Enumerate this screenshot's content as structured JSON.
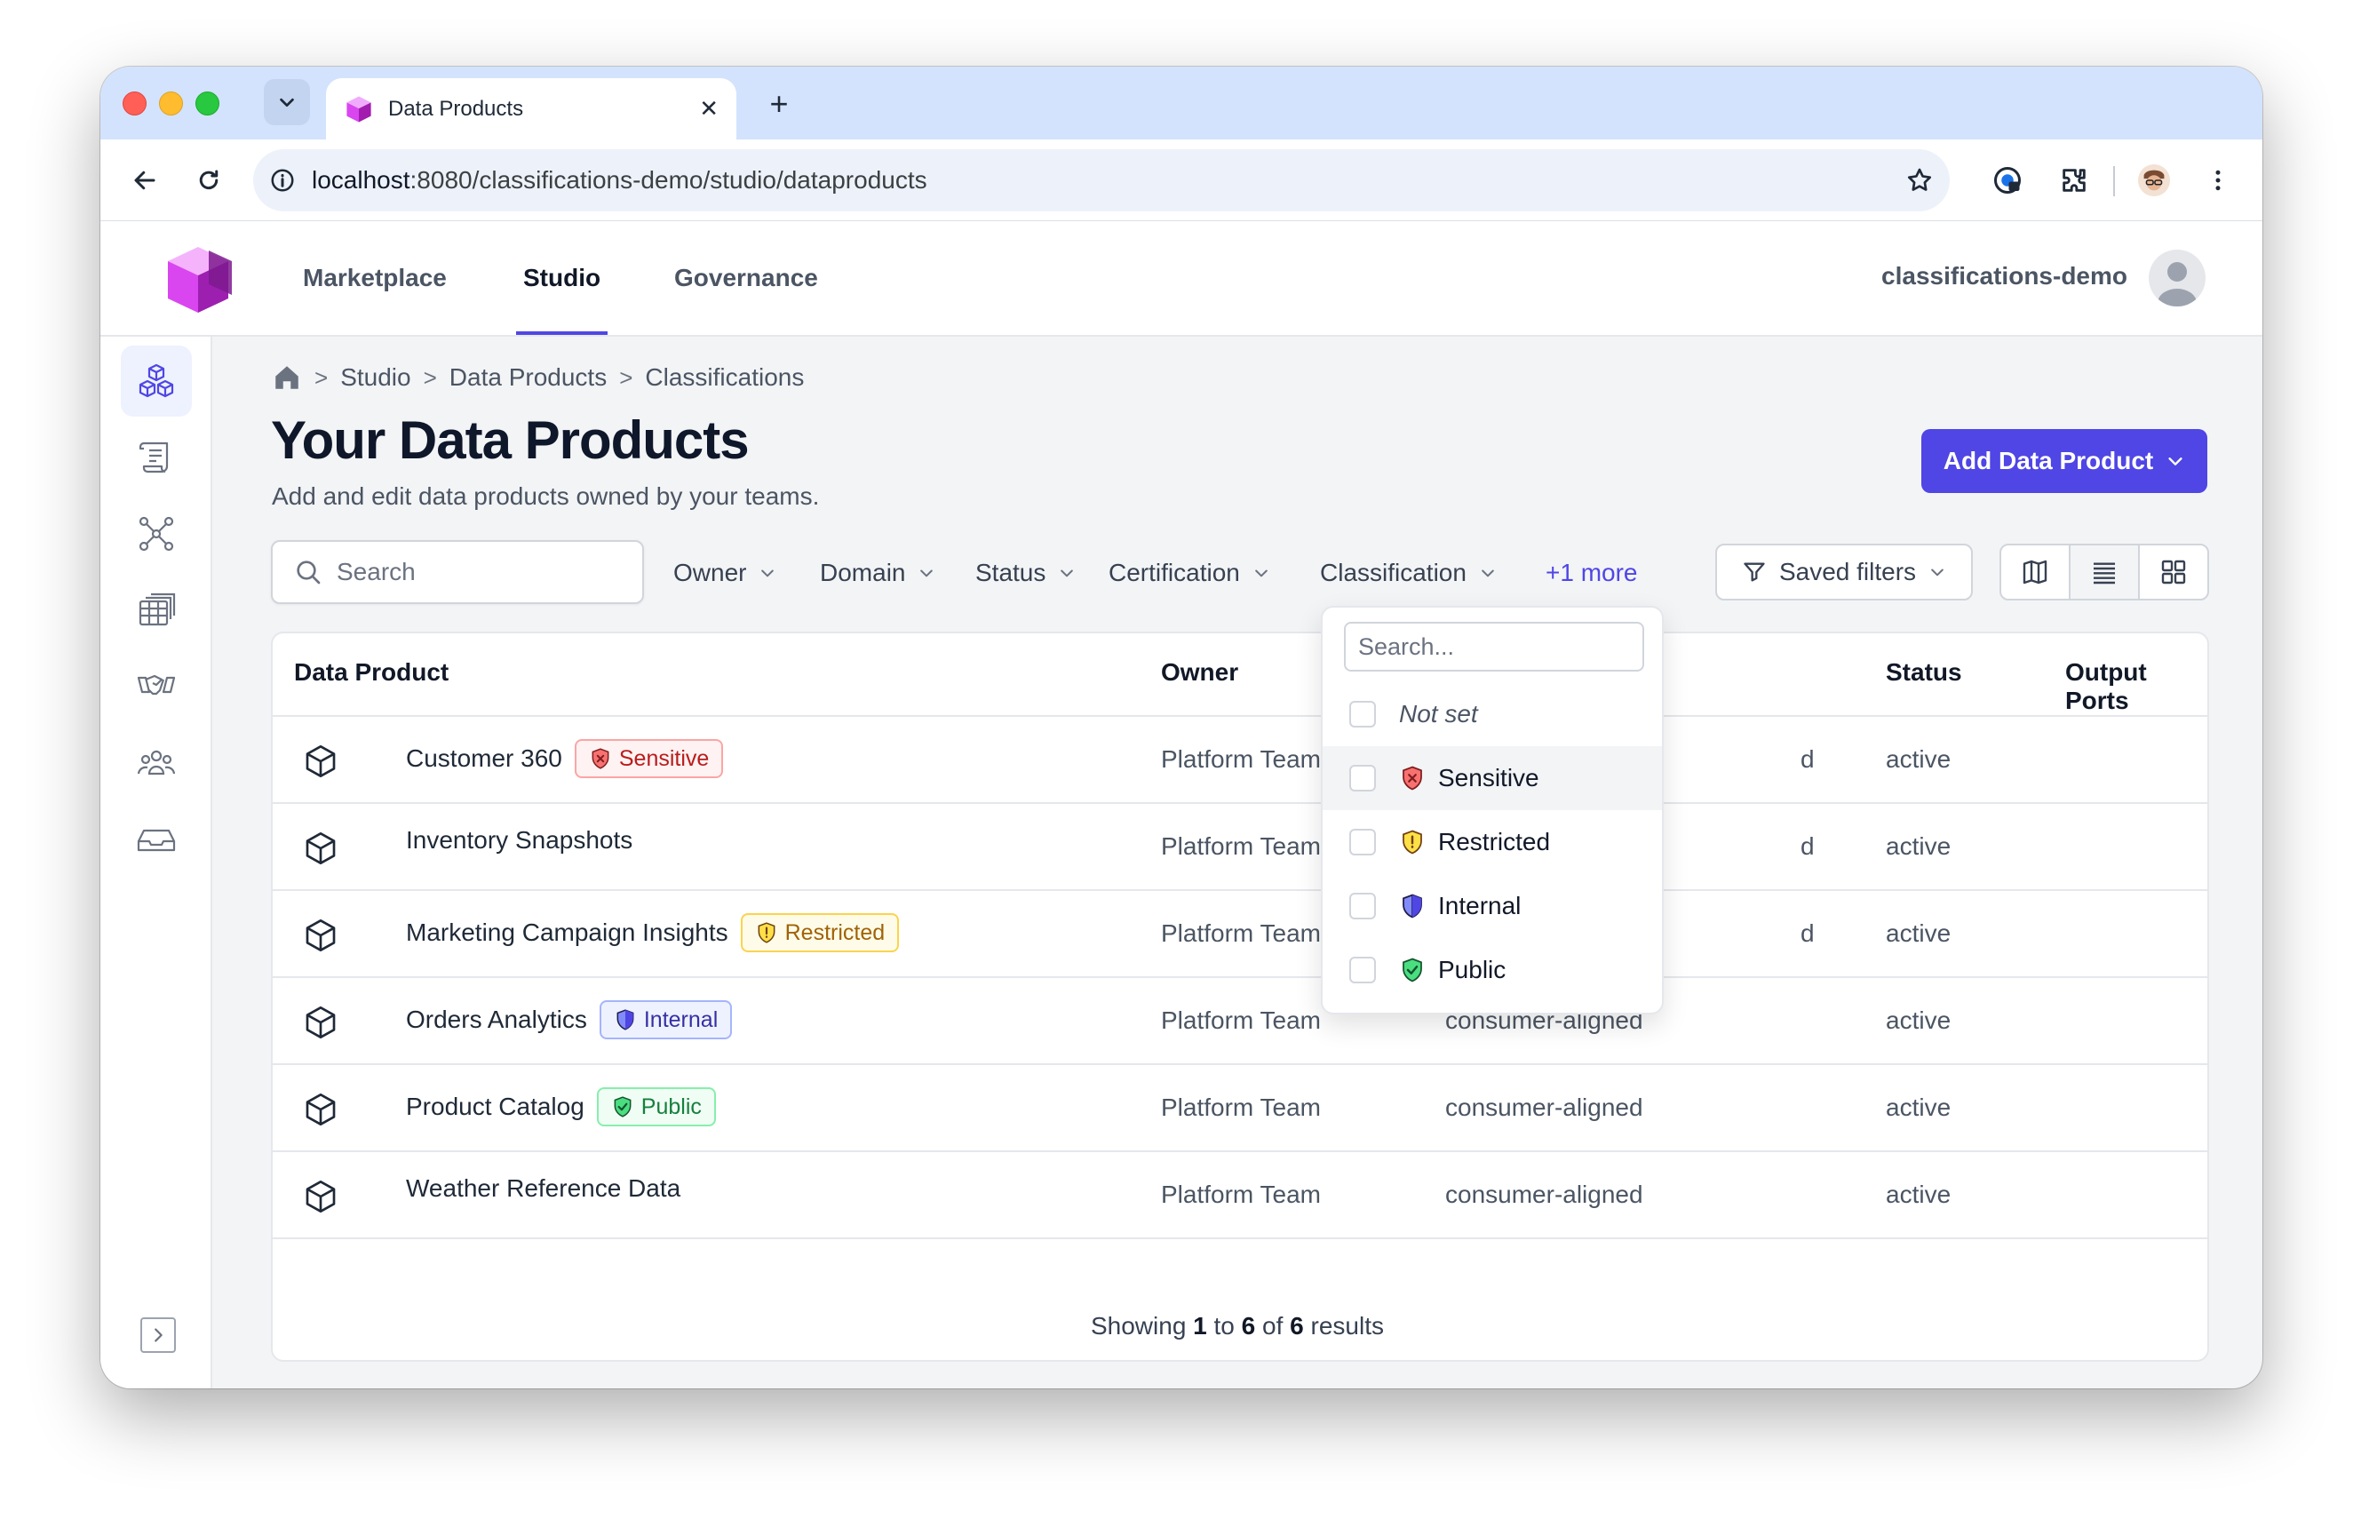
{
  "browser": {
    "tab_title": "Data Products",
    "url_host": "localhost",
    "url_path": ":8080/classifications-demo/studio/dataproducts"
  },
  "header": {
    "nav": [
      "Marketplace",
      "Studio",
      "Governance"
    ],
    "active_nav": "Studio",
    "tenant": "classifications-demo"
  },
  "breadcrumb": [
    "Studio",
    "Data Products",
    "Classifications"
  ],
  "page": {
    "title": "Your Data Products",
    "subtitle": "Add and edit data products owned by your teams.",
    "add_button": "Add Data Product"
  },
  "filters": {
    "search_placeholder": "Search",
    "items": [
      "Owner",
      "Domain",
      "Status",
      "Certification",
      "Classification"
    ],
    "more": "+1 more",
    "saved": "Saved filters"
  },
  "table": {
    "columns": [
      "Data Product",
      "Owner",
      "Status",
      "Output Ports"
    ],
    "rows": [
      {
        "name": "Customer 360",
        "badge": "Sensitive",
        "badge_type": "sensitive",
        "owner": "Platform Team",
        "domain": "d",
        "status": "active"
      },
      {
        "name": "Inventory Snapshots",
        "badge": "",
        "badge_type": "",
        "owner": "Platform Team",
        "domain": "d",
        "status": "active"
      },
      {
        "name": "Marketing Campaign Insights",
        "badge": "Restricted",
        "badge_type": "restricted",
        "owner": "Platform Team",
        "domain": "d",
        "status": "active"
      },
      {
        "name": "Orders Analytics",
        "badge": "Internal",
        "badge_type": "internal",
        "owner": "Platform Team",
        "domain": "consumer-aligned",
        "status": "active"
      },
      {
        "name": "Product Catalog",
        "badge": "Public",
        "badge_type": "public",
        "owner": "Platform Team",
        "domain": "consumer-aligned",
        "status": "active"
      },
      {
        "name": "Weather Reference Data",
        "badge": "",
        "badge_type": "",
        "owner": "Platform Team",
        "domain": "consumer-aligned",
        "status": "active"
      }
    ]
  },
  "pagination": {
    "prefix": "Showing",
    "from": "1",
    "to_word": "to",
    "to": "6",
    "of_word": "of",
    "total": "6",
    "suffix": "results"
  },
  "dropdown": {
    "search_placeholder": "Search...",
    "options": [
      "Not set",
      "Sensitive",
      "Restricted",
      "Internal",
      "Public"
    ]
  },
  "colors": {
    "accent": "#4f46e5",
    "sensitive": "#ef4444",
    "restricted": "#facc15",
    "internal": "#6366f1",
    "public": "#22c55e"
  }
}
